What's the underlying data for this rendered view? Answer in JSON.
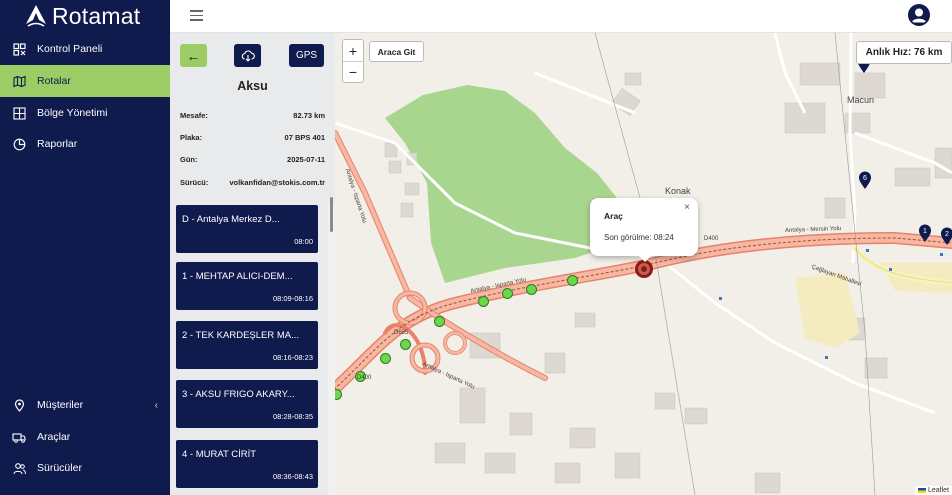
{
  "app": {
    "brand": "Rotamat"
  },
  "sidebar": {
    "items": [
      {
        "label": "Kontrol Paneli",
        "icon": "dashboard-icon"
      },
      {
        "label": "Rotalar",
        "icon": "map-icon",
        "active": true
      },
      {
        "label": "Bölge Yönetimi",
        "icon": "region-icon"
      },
      {
        "label": "Raporlar",
        "icon": "report-icon"
      }
    ],
    "bottom_items": [
      {
        "label": "Müşteriler",
        "icon": "location-pin-icon",
        "chevron": "‹"
      },
      {
        "label": "Araçlar",
        "icon": "truck-icon"
      },
      {
        "label": "Sürücüler",
        "icon": "users-icon"
      }
    ]
  },
  "panel": {
    "buttons": {
      "back": "←",
      "gps": "GPS"
    },
    "title": "Aksu",
    "info": {
      "distance_label": "Mesafe:",
      "distance": "82.73 km",
      "plate_label": "Plaka:",
      "plate": "07 BPS 401",
      "day_label": "Gün:",
      "day": "2025-07-11",
      "driver_label": "Sürücü:",
      "driver": "volkanfidan@stokis.com.tr"
    },
    "stops": [
      {
        "name": "D - Antalya Merkez D...",
        "time": "08:00"
      },
      {
        "name": "1 - MEHTAP ALICI-DEM...",
        "time": "08:09-08:16"
      },
      {
        "name": "2 - TEK KARDEŞLER MA...",
        "time": "08:16-08:23"
      },
      {
        "name": "3 - AKSU FRIGO AKARY...",
        "time": "08:28-08:35"
      },
      {
        "name": "4 - MURAT CİRİT",
        "time": "08:36-08:43"
      }
    ]
  },
  "map": {
    "zoom_in": "+",
    "zoom_out": "−",
    "go_to_vehicle": "Araca Git",
    "speed": "Anlık Hız: 76 km",
    "popup": {
      "title": "Araç",
      "text": "Son görülme: 08:24",
      "close": "×"
    },
    "labels": {
      "konak": "Konak",
      "macun": "Macun",
      "d400": "D400",
      "d685": "D685",
      "isparta_road_1": "Antalya - Isparta Yolu",
      "isparta_road_2": "Antalya - Isparta Yolu",
      "isparta_road_3": "Antalya - Isparta Yolu",
      "mersin_road": "Antalya - Mersin Yolu",
      "caglayan": "Çağlayan Mahallesi",
      "d400_left": "D400",
      "d650": "650"
    },
    "markers": [
      "6",
      "1",
      "2"
    ],
    "attribution": "Leaflet",
    "colors": {
      "road_primary": "#f0a48a",
      "park": "#a9d68f",
      "stop_dot": "#6bd74a",
      "marker": "#0f1a4d",
      "vehicle": "#8b1a1a"
    }
  }
}
